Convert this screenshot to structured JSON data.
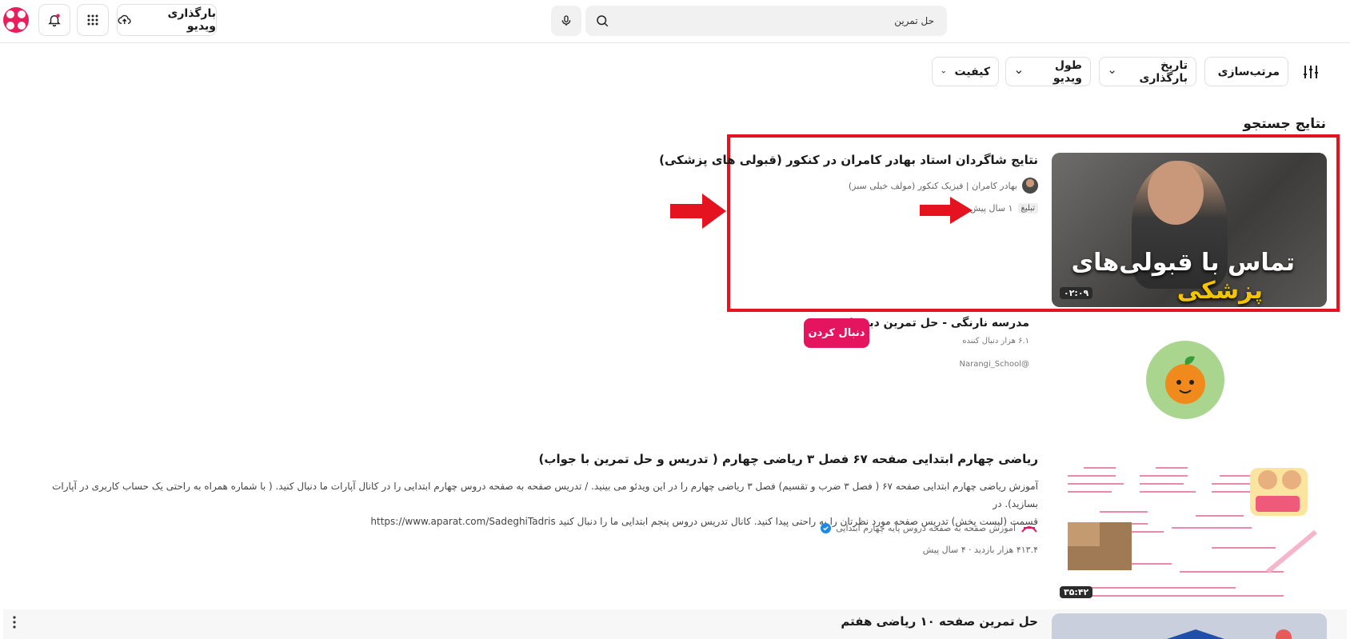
{
  "header": {
    "search_value": "حل تمرین",
    "upload_label": "بارگذاری ویدیو"
  },
  "filters": [
    {
      "label": "مرتب‌سازی"
    },
    {
      "label": "تاریخ بارگذاری"
    },
    {
      "label": "طول ویدیو"
    },
    {
      "label": "کیفیت"
    }
  ],
  "section_title": "نتایج جستجو",
  "results": [
    {
      "title": "نتایج شاگردان استاد بهادر کامران در کنکور (قبولی های پزشکی)",
      "channel": "بهادر کامران | فیزیک کنکور (مولف خیلی سبز)",
      "ad_badge": "تبلیغ",
      "age": "۱ سال پیش",
      "duration": "۰۲:۰۹",
      "thumb_caption_1": "تماس با قبولی‌های",
      "thumb_caption_2": "پزشکی"
    },
    {
      "title": "ریاضی چهارم ابتدایی صفحه ۶۷ فصل ۳ ریاضی چهارم ( تدریس و حل تمرین با جواب)",
      "description_line1": "آموزش ریاضی چهارم ابتدایی صفحه ۶۷ ( فصل ۳ ضرب و تقسیم) فصل ۳ ریاضی چهارم را در این ویدئو می بینید. / تدریس صفحه به صفحه دروس چهارم ابتدایی را در کانال آپارات ما دنبال کنید. ( با شماره همراه به راحتی یک حساب کاربری در آپارات بسازید). در",
      "description_line2": "قسمت (لیست پخش) تدریس صفحه مورد نظرتان را به راحتی پیدا کنید. کانال تدریس دروس پنجم ابتدایی ما را دنبال کنید  https://www.aparat.com/SadeghiTadris",
      "channel": "آموزش صفحه به صفحه دروس پایه چهارم ابتدایی",
      "views_age": "۴۱۳.۴ هزار بازدید · ۴ سال پیش",
      "duration": "۳۵:۴۲"
    },
    {
      "title": "حل تمرین صفحه ۱۰ ریاضی هفتم"
    }
  ],
  "channel_card": {
    "name": "مدرسه نارنگی - حل تمرین دبستان",
    "subscribers": "۶.۱ هزار دنبال کننده",
    "handle": "@Narangi_School",
    "follow_label": "دنبال کردن"
  },
  "colors": {
    "brand": "#ea1d5d",
    "highlight_border": "#e4131f",
    "follow_button": "#e4155e"
  }
}
